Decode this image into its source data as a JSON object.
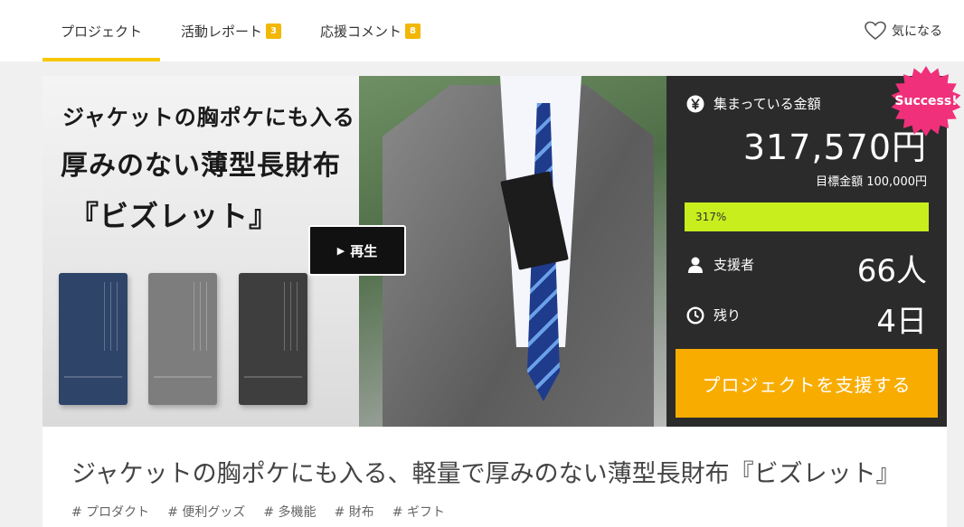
{
  "tabs": {
    "project": "プロジェクト",
    "report": "活動レポート",
    "report_count": "3",
    "comment": "応援コメント",
    "comment_count": "8",
    "favorite": "気になる"
  },
  "hero": {
    "copy_line1": "ジャケットの胸ポケにも入る",
    "copy_line2": "厚みのない薄型長財布",
    "copy_line3": "『ビズレット』",
    "play_icon": "▶",
    "play_label": "再生"
  },
  "stats": {
    "raised_label": "集まっている金額",
    "raised_amount": "317,570円",
    "goal_text": "目標金額 100,000円",
    "progress_percent": 317,
    "progress_text": "317%",
    "backers_label": "支援者",
    "backers_value": "66人",
    "remaining_label": "残り",
    "remaining_value": "4日",
    "support_button": "プロジェクトを支援する",
    "success_badge": "Success!",
    "colors": {
      "panel": "#2b2b2b",
      "progress": "#c8ee1e",
      "button": "#f8ac00",
      "badge": "#f0307a",
      "tab_accent": "#f8c800"
    }
  },
  "project": {
    "title": "ジャケットの胸ポケにも入る、軽量で厚みのない薄型長財布『ビズレット』",
    "tags": [
      "# プロダクト",
      "# 便利グッズ",
      "# 多機能",
      "# 財布",
      "# ギフト"
    ]
  },
  "icons": [
    "heart-icon",
    "yen-icon",
    "person-icon",
    "clock-icon",
    "play-icon"
  ]
}
